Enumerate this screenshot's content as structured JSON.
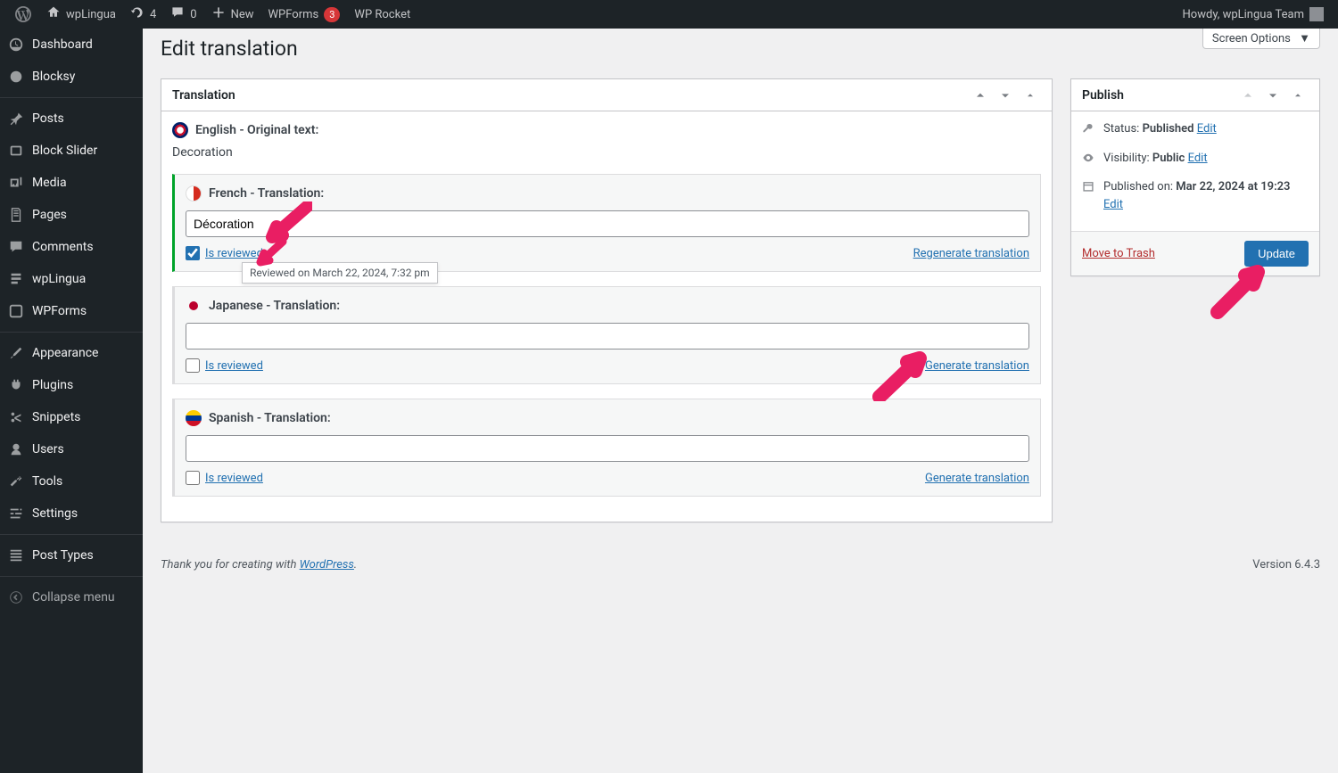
{
  "adminbar": {
    "site": "wpLingua",
    "updates": "4",
    "comments": "0",
    "new": "New",
    "wpforms": "WPForms",
    "wpforms_count": "3",
    "wprocket": "WP Rocket",
    "howdy": "Howdy, wpLingua Team"
  },
  "sidebar": {
    "dashboard": "Dashboard",
    "blocksy": "Blocksy",
    "posts": "Posts",
    "blockslider": "Block Slider",
    "media": "Media",
    "pages": "Pages",
    "comments": "Comments",
    "wplingua": "wpLingua",
    "wpforms": "WPForms",
    "appearance": "Appearance",
    "plugins": "Plugins",
    "snippets": "Snippets",
    "users": "Users",
    "tools": "Tools",
    "settings": "Settings",
    "posttypes": "Post Types",
    "collapse": "Collapse menu"
  },
  "screen_options": "Screen Options",
  "page_title": "Edit translation",
  "translation": {
    "panel_title": "Translation",
    "original_label": "English - Original text:",
    "original_text": "Decoration",
    "langs": [
      {
        "label": "French - Translation:",
        "value": "Décoration",
        "reviewed": true,
        "reviewed_label": "Is reviewed",
        "action": "Regenerate translation",
        "flag": "flag-fr",
        "tooltip": "Reviewed on March 22, 2024, 7:32 pm"
      },
      {
        "label": "Japanese - Translation:",
        "value": "",
        "reviewed": false,
        "reviewed_label": "Is reviewed",
        "action": "Generate translation",
        "flag": "flag-jp"
      },
      {
        "label": "Spanish - Translation:",
        "value": "",
        "reviewed": false,
        "reviewed_label": "Is reviewed",
        "action": "Generate translation",
        "flag": "flag-es"
      }
    ]
  },
  "publish": {
    "panel_title": "Publish",
    "status_label": "Status:",
    "status_value": "Published",
    "visibility_label": "Visibility:",
    "visibility_value": "Public",
    "published_label": "Published on:",
    "published_value": "Mar 22, 2024 at 19:23",
    "edit": "Edit",
    "trash": "Move to Trash",
    "update": "Update"
  },
  "footer": {
    "thanks": "Thank you for creating with ",
    "wp": "WordPress",
    "period": ".",
    "version": "Version 6.4.3"
  }
}
